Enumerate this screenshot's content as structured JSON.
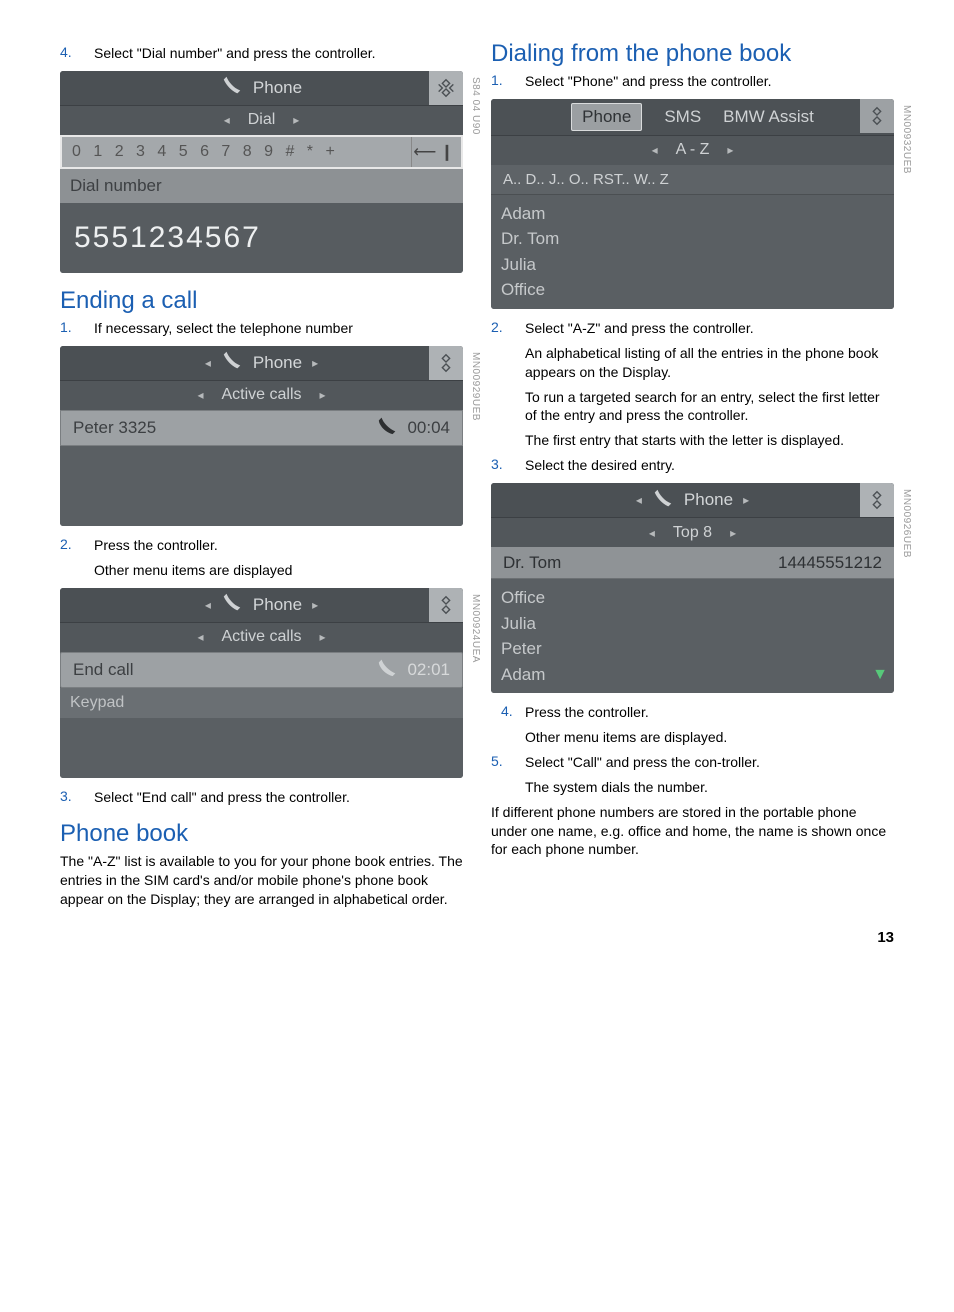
{
  "left": {
    "step4": {
      "num": "4.",
      "text": "Select \"Dial number\" and press the controller."
    },
    "screen1": {
      "title": "Phone",
      "sub": "Dial",
      "chars": "0 1 2 3 4 5 6 7 8 9 # * +",
      "dialLabel": "Dial number",
      "bigNum": "5551234567",
      "code": "S84 04 U90"
    },
    "h_ending": "Ending a call",
    "step1": {
      "num": "1.",
      "text": "If necessary, select the telephone number"
    },
    "screen2": {
      "title": "Phone",
      "sub": "Active calls",
      "name": "Peter",
      "ext": "3325",
      "time": "00:04",
      "code": "MN00929UEB"
    },
    "step2": {
      "num": "2.",
      "text": "Press the controller.",
      "sub": "Other menu items are displayed"
    },
    "screen3": {
      "title": "Phone",
      "sub": "Active calls",
      "endcall": "End call",
      "keypad": "Keypad",
      "time": "02:01",
      "code": "MN00924UEA"
    },
    "step3": {
      "num": "3.",
      "text": "Select \"End call\" and press the controller."
    },
    "h_book": "Phone book",
    "book_para": "The \"A-Z\" list is available to you for your phone book entries. The entries in the SIM card's and/or mobile phone's phone book appear on the Display; they are arranged in alphabetical order."
  },
  "right": {
    "h_dialing": "Dialing from the phone book",
    "step1": {
      "num": "1.",
      "text": "Select \"Phone\" and press the controller."
    },
    "screen4": {
      "tabs": {
        "phone": "Phone",
        "sms": "SMS",
        "assist": "BMW Assist"
      },
      "sub": "A - Z",
      "letters": "A..  D..  J..  O..  RST..  W.. Z",
      "names": [
        "Adam",
        "Dr. Tom",
        "Julia",
        "Office"
      ],
      "code": "MN00932UEB"
    },
    "step2": {
      "num": "2.",
      "text": "Select \"A-Z\" and press the controller.",
      "sub1": "An alphabetical listing of all the entries in the phone book appears on the Display.",
      "sub2": "To run a targeted search for an entry, select the first letter of the entry and press the controller.",
      "sub3": "The first entry that starts with the letter is displayed."
    },
    "step3": {
      "num": "3.",
      "text": "Select the desired entry."
    },
    "screen5": {
      "title": "Phone",
      "sub": "Top 8",
      "selName": "Dr. Tom",
      "selNum": "14445551212",
      "names": [
        "Office",
        "Julia",
        "Peter",
        "Adam"
      ],
      "code": "MN00926UEB"
    },
    "step4": {
      "num": "4.",
      "text": "Press the controller.",
      "sub": "Other menu items are displayed."
    },
    "step5": {
      "num": "5.",
      "text": "Select \"Call\" and press the con-troller.",
      "sub": "The system dials the number."
    },
    "tail": "If different phone numbers are stored in the portable phone under one name, e.g. office and home, the name is shown once for each phone number."
  },
  "pageNum": "13"
}
